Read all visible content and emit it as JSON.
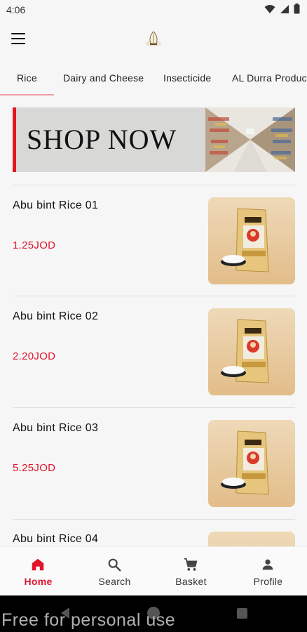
{
  "status_bar": {
    "time": "4:06"
  },
  "app_bar": {
    "menu_icon": "menu-icon",
    "logo_icon": "app-logo"
  },
  "tabs": [
    {
      "label": "Rice",
      "active": true
    },
    {
      "label": "Dairy and Cheese",
      "active": false
    },
    {
      "label": "Insecticide",
      "active": false
    },
    {
      "label": "AL Durra Products",
      "active": false
    }
  ],
  "banner": {
    "text": "SHOP NOW"
  },
  "products": [
    {
      "name": "Abu bint Rice 01",
      "price": "1.25JOD"
    },
    {
      "name": "Abu bint Rice 02",
      "price": "2.20JOD"
    },
    {
      "name": "Abu bint Rice 03",
      "price": "5.25JOD"
    },
    {
      "name": "Abu bint Rice 04",
      "price": ""
    }
  ],
  "bottom_nav": [
    {
      "label": "Home",
      "icon": "home-icon",
      "active": true
    },
    {
      "label": "Search",
      "icon": "search-icon",
      "active": false
    },
    {
      "label": "Basket",
      "icon": "cart-icon",
      "active": false
    },
    {
      "label": "Profile",
      "icon": "person-icon",
      "active": false
    }
  ],
  "watermark": "Free for personal use",
  "colors": {
    "accent": "#e0142b",
    "tab_indicator": "#f2a0a6"
  }
}
